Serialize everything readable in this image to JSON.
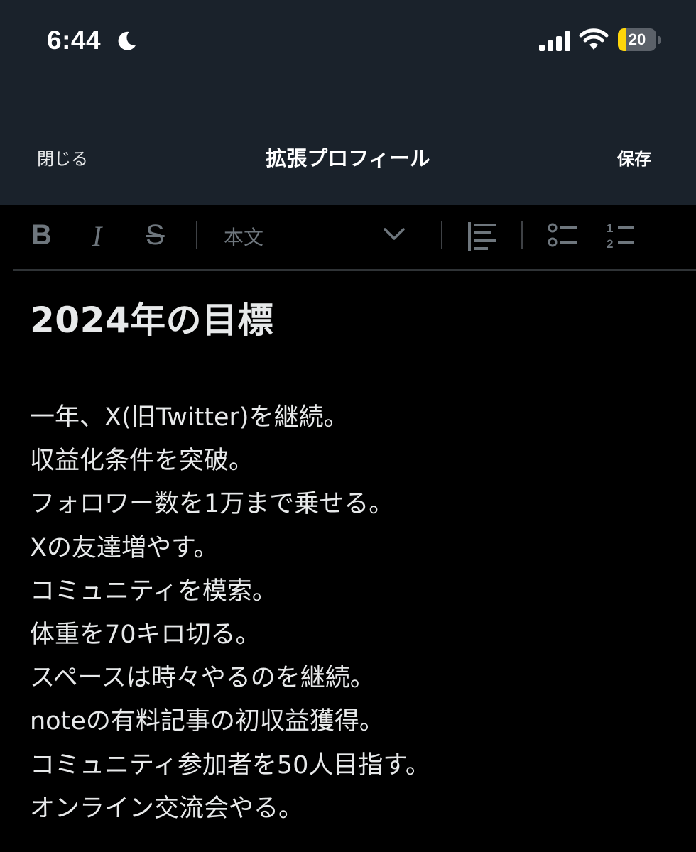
{
  "status_bar": {
    "time": "6:44",
    "battery_percent": "20",
    "battery_level": 0.2
  },
  "nav": {
    "close_label": "閉じる",
    "title": "拡張プロフィール",
    "save_label": "保存"
  },
  "toolbar": {
    "bold_label": "B",
    "italic_label": "I",
    "strike_label": "S",
    "style_value": "本文"
  },
  "document": {
    "heading": "2024年の目標",
    "lines": [
      "一年、X(旧Twitter)を継続。",
      "収益化条件を突破。",
      "フォロワー数を1万まで乗せる。",
      "Xの友達増やす。",
      "コミュニティを模索。",
      "体重を70キロ切る。",
      "スペースは時々やるのを継続。",
      "noteの有料記事の初収益獲得。",
      "コミュニティ参加者を50人目指す。",
      "オンライン交流会やる。"
    ]
  },
  "colors": {
    "header_bg": "#1a222b",
    "editor_bg": "#000000",
    "text": "#e7e9ea",
    "toolbar_icon": "#6e767d",
    "battery_fill": "#ffd60a"
  },
  "icons": [
    "moon-icon",
    "signal-icon",
    "wifi-icon",
    "battery-icon",
    "chevron-down-icon",
    "align-left-icon",
    "bullet-list-icon",
    "numbered-list-icon"
  ]
}
